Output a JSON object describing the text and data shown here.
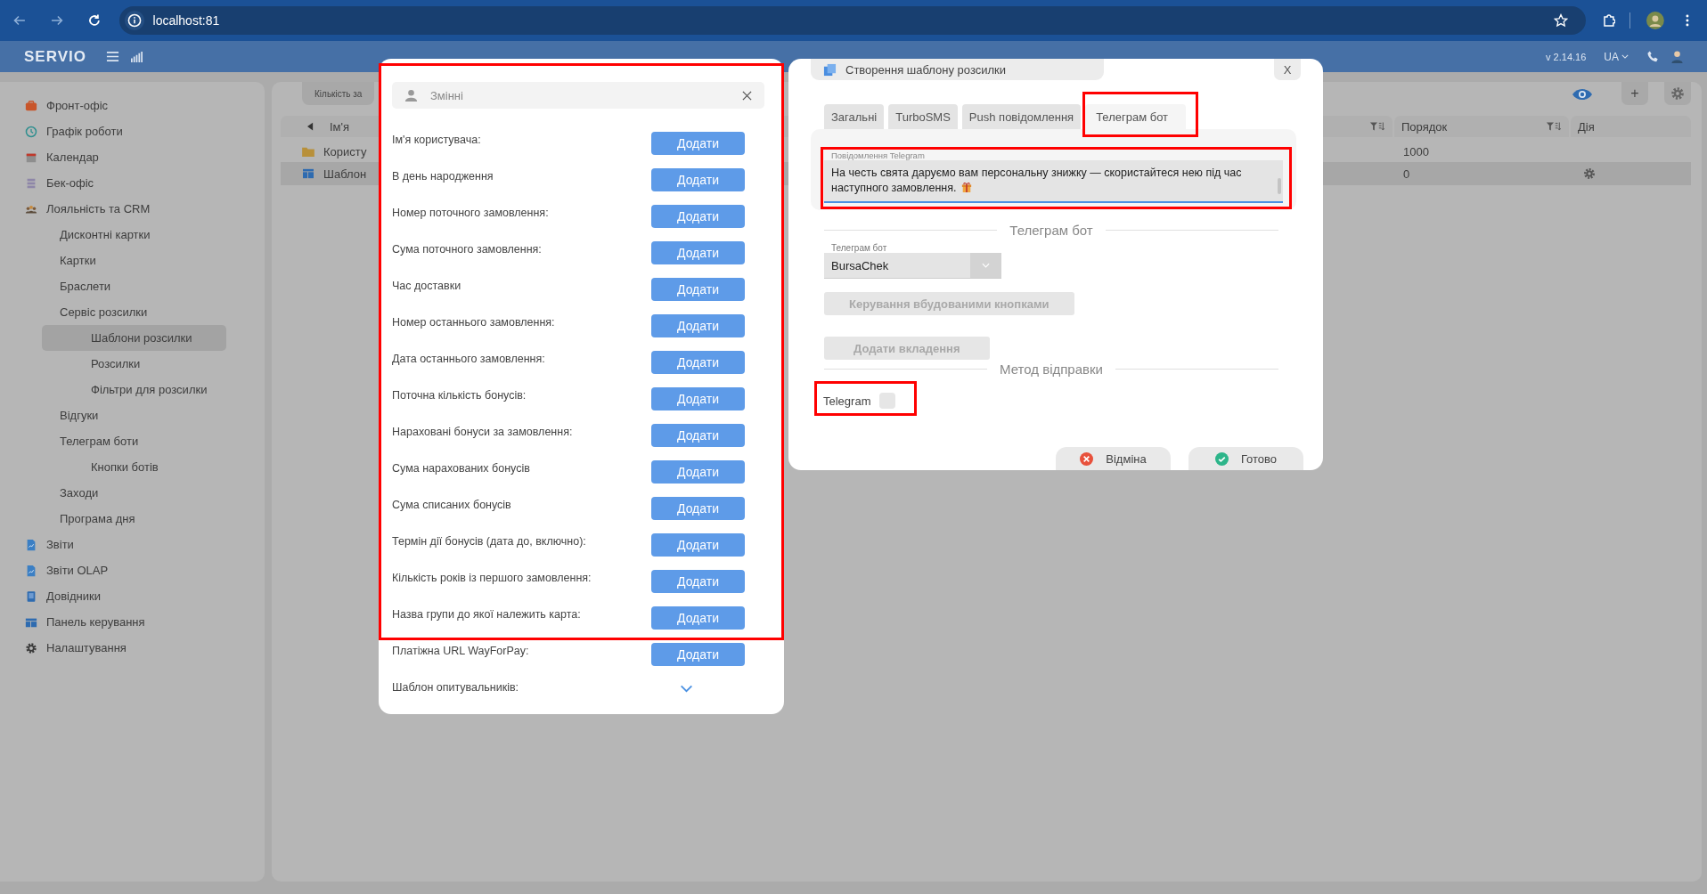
{
  "browser": {
    "address": "localhost:81"
  },
  "app_header": {
    "logo": "SERVIO",
    "version": "v 2.14.16",
    "language": "UA"
  },
  "sidebar": {
    "items": [
      {
        "label": "Фронт-офіс",
        "selected": false
      },
      {
        "label": "Графік роботи",
        "selected": false
      },
      {
        "label": "Календар",
        "selected": false
      },
      {
        "label": "Бек-офіс",
        "selected": false
      },
      {
        "label": "Лояльність та CRM",
        "selected": false,
        "children": [
          {
            "label": "Дисконтні картки",
            "selected": false
          },
          {
            "label": "Картки",
            "selected": false
          },
          {
            "label": "Браслети",
            "selected": false
          },
          {
            "label": "Сервіс розсилки",
            "selected": false,
            "children": [
              {
                "label": "Шаблони розсилки",
                "selected": true
              },
              {
                "label": "Розсилки",
                "selected": false
              },
              {
                "label": "Фільтри для розсилки",
                "selected": false
              }
            ]
          },
          {
            "label": "Відгуки",
            "selected": false
          },
          {
            "label": "Телеграм боти",
            "selected": false,
            "children": [
              {
                "label": "Кнопки ботів",
                "selected": false
              }
            ]
          },
          {
            "label": "Заходи",
            "selected": false
          },
          {
            "label": "Програма дня",
            "selected": false
          }
        ]
      },
      {
        "label": "Звіти",
        "selected": false
      },
      {
        "label": "Звіти OLAP",
        "selected": false
      },
      {
        "label": "Довідники",
        "selected": false
      },
      {
        "label": "Панель керування",
        "selected": false
      },
      {
        "label": "Налаштування",
        "selected": false
      }
    ]
  },
  "main": {
    "toolbar_tab": "Кількість за",
    "add_button": "+",
    "table": {
      "columns": [
        {
          "label": "Ім'я",
          "filter": true
        },
        {
          "label": "Порядок",
          "filter": true
        },
        {
          "label": "Дія",
          "filter": false
        }
      ],
      "rows": [
        {
          "kind": "folder",
          "name": "Користу",
          "order": "1000",
          "settings": false,
          "selected": false
        },
        {
          "kind": "template",
          "name": "Шаблон",
          "order": "0",
          "settings": true,
          "selected": true
        }
      ]
    }
  },
  "variables_dialog": {
    "title": "Змінні",
    "items": [
      {
        "kind": "button",
        "label": "Ім'я користувача:",
        "action": "Додати"
      },
      {
        "kind": "button",
        "label": "В день народження",
        "action": "Додати"
      },
      {
        "kind": "button",
        "label": "Номер поточного замовлення:",
        "action": "Додати"
      },
      {
        "kind": "button",
        "label": "Сума поточного замовлення:",
        "action": "Додати"
      },
      {
        "kind": "button",
        "label": "Час доставки",
        "action": "Додати"
      },
      {
        "kind": "button",
        "label": "Номер останнього замовлення:",
        "action": "Додати"
      },
      {
        "kind": "button",
        "label": "Дата останнього замовлення:",
        "action": "Додати"
      },
      {
        "kind": "button",
        "label": "Поточна кількість бонусів:",
        "action": "Додати"
      },
      {
        "kind": "button",
        "label": "Нараховані бонуси за замовлення:",
        "action": "Додати"
      },
      {
        "kind": "button",
        "label": "Сума нарахованих бонусів",
        "action": "Додати"
      },
      {
        "kind": "button",
        "label": "Сума списаних бонусів",
        "action": "Додати"
      },
      {
        "kind": "button",
        "label": "Термін дії бонусів (дата до, включно):",
        "action": "Додати"
      },
      {
        "kind": "button",
        "label": "Кількість років із першого замовлення:",
        "action": "Додати"
      },
      {
        "kind": "button",
        "label": "Назва групи до якої належить карта:",
        "action": "Додати"
      },
      {
        "kind": "button",
        "label": "Платіжна URL WayForPay:",
        "action": "Додати"
      },
      {
        "kind": "dropdown",
        "label": "Шаблон опитувальників:"
      }
    ]
  },
  "template_dialog": {
    "title": "Створення шаблону розсилки",
    "close": "X",
    "tabs": [
      {
        "label": "Загальні",
        "selected": false
      },
      {
        "label": "TurboSMS",
        "selected": false
      },
      {
        "label": "Push повідомлення",
        "selected": false
      },
      {
        "label": "Телеграм бот",
        "selected": true
      }
    ],
    "message": {
      "label": "Повідомлення Telegram",
      "lines": [
        "На честь свята даруємо вам персональну знижку — скористайтеся нею під час наступного замовлення."
      ]
    },
    "bot_section": "Телеграм бот",
    "bot_select": {
      "label": "Телеграм бот",
      "value": "BursaChek"
    },
    "actions": [
      {
        "label": "Керування вбудованими кнопками",
        "disabled": true
      },
      {
        "label": "Додати вкладення",
        "disabled": true
      }
    ],
    "method_section": "Метод відправки",
    "methods": [
      {
        "label": "Telegram",
        "checked": false
      }
    ],
    "footer": [
      {
        "kind": "cancel",
        "label": "Відміна"
      },
      {
        "kind": "ok",
        "label": "Готово"
      }
    ]
  }
}
